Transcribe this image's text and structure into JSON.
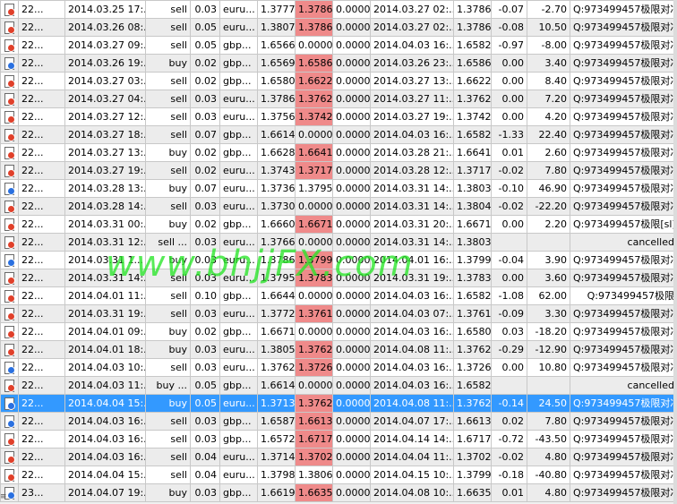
{
  "watermark": "www.bhjjFX.com",
  "left_glyph": "≡",
  "columns": [
    "icon",
    "ticket",
    "open_time",
    "type",
    "volume",
    "symbol",
    "open_price",
    "sl",
    "tp",
    "close_time",
    "close_price",
    "swap",
    "profit",
    "comment"
  ],
  "rows": [
    {
      "icon": "red",
      "ticket": "22...",
      "open_time": "2014.03.25 17:...",
      "type": "sell",
      "volume": "0.03",
      "symbol": "euru...",
      "open_price": "1.3777",
      "sl": "1.3786",
      "sl_hl": true,
      "tp": "0.0000",
      "close_time": "2014.03.27 02:...",
      "close_price": "1.3786",
      "swap": "-0.07",
      "profit": "-2.70",
      "comment": "Q:973499457极限对冲"
    },
    {
      "icon": "red",
      "ticket": "22...",
      "open_time": "2014.03.26 08:...",
      "type": "sell",
      "volume": "0.05",
      "symbol": "euru...",
      "open_price": "1.3807",
      "sl": "1.3786",
      "sl_hl": true,
      "tp": "0.0000",
      "close_time": "2014.03.27 02:...",
      "close_price": "1.3786",
      "swap": "-0.08",
      "profit": "10.50",
      "comment": "Q:973499457极限对冲"
    },
    {
      "icon": "red",
      "ticket": "22...",
      "open_time": "2014.03.27 09:...",
      "type": "sell",
      "volume": "0.05",
      "symbol": "gbp...",
      "open_price": "1.6566",
      "sl": "0.0000",
      "sl_hl": false,
      "tp": "0.0000",
      "close_time": "2014.04.03 16:...",
      "close_price": "1.6582",
      "swap": "-0.97",
      "profit": "-8.00",
      "comment": "Q:973499457极限对冲"
    },
    {
      "icon": "blue",
      "ticket": "22...",
      "open_time": "2014.03.26 19:...",
      "type": "buy",
      "volume": "0.02",
      "symbol": "gbp...",
      "open_price": "1.6569",
      "sl": "1.6586",
      "sl_hl": true,
      "tp": "0.0000",
      "close_time": "2014.03.26 23:...",
      "close_price": "1.6586",
      "swap": "0.00",
      "profit": "3.40",
      "comment": "Q:973499457极限对冲"
    },
    {
      "icon": "red",
      "ticket": "22...",
      "open_time": "2014.03.27 03:...",
      "type": "sell",
      "volume": "0.02",
      "symbol": "gbp...",
      "open_price": "1.6580",
      "sl": "1.6622",
      "sl_hl": true,
      "tp": "0.0000",
      "close_time": "2014.03.27 13:...",
      "close_price": "1.6622",
      "swap": "0.00",
      "profit": "8.40",
      "comment": "Q:973499457极限对冲"
    },
    {
      "icon": "red",
      "ticket": "22...",
      "open_time": "2014.03.27 04:...",
      "type": "sell",
      "volume": "0.03",
      "symbol": "euru...",
      "open_price": "1.3786",
      "sl": "1.3762",
      "sl_hl": true,
      "tp": "0.0000",
      "close_time": "2014.03.27 11:...",
      "close_price": "1.3762",
      "swap": "0.00",
      "profit": "7.20",
      "comment": "Q:973499457极限对冲"
    },
    {
      "icon": "red",
      "ticket": "22...",
      "open_time": "2014.03.27 12:...",
      "type": "sell",
      "volume": "0.03",
      "symbol": "euru...",
      "open_price": "1.3756",
      "sl": "1.3742",
      "sl_hl": true,
      "tp": "0.0000",
      "close_time": "2014.03.27 19:...",
      "close_price": "1.3742",
      "swap": "0.00",
      "profit": "4.20",
      "comment": "Q:973499457极限对冲"
    },
    {
      "icon": "red",
      "ticket": "22...",
      "open_time": "2014.03.27 18:...",
      "type": "sell",
      "volume": "0.07",
      "symbol": "gbp...",
      "open_price": "1.6614",
      "sl": "0.0000",
      "sl_hl": false,
      "tp": "0.0000",
      "close_time": "2014.04.03 16:...",
      "close_price": "1.6582",
      "swap": "-1.33",
      "profit": "22.40",
      "comment": "Q:973499457极限对冲"
    },
    {
      "icon": "red",
      "ticket": "22...",
      "open_time": "2014.03.27 13:...",
      "type": "buy",
      "volume": "0.02",
      "symbol": "gbp...",
      "open_price": "1.6628",
      "sl": "1.6641",
      "sl_hl": true,
      "tp": "0.0000",
      "close_time": "2014.03.28 21:...",
      "close_price": "1.6641",
      "swap": "0.01",
      "profit": "2.60",
      "comment": "Q:973499457极限对冲"
    },
    {
      "icon": "red",
      "ticket": "22...",
      "open_time": "2014.03.27 19:...",
      "type": "sell",
      "volume": "0.02",
      "symbol": "euru...",
      "open_price": "1.3743",
      "sl": "1.3717",
      "sl_hl": true,
      "tp": "0.0000",
      "close_time": "2014.03.28 12:...",
      "close_price": "1.3717",
      "swap": "-0.02",
      "profit": "7.80",
      "comment": "Q:973499457极限对冲"
    },
    {
      "icon": "blue",
      "ticket": "22...",
      "open_time": "2014.03.28 13:...",
      "type": "buy",
      "volume": "0.07",
      "symbol": "euru...",
      "open_price": "1.3736",
      "sl": "1.3795",
      "sl_hl": false,
      "tp": "0.0000",
      "close_time": "2014.03.31 14:...",
      "close_price": "1.3803",
      "swap": "-0.10",
      "profit": "46.90",
      "comment": "Q:973499457极限对冲"
    },
    {
      "icon": "red",
      "ticket": "22...",
      "open_time": "2014.03.28 14:...",
      "type": "sell",
      "volume": "0.03",
      "symbol": "euru...",
      "open_price": "1.3730",
      "sl": "0.0000",
      "sl_hl": false,
      "tp": "0.0000",
      "close_time": "2014.03.31 14:...",
      "close_price": "1.3804",
      "swap": "-0.02",
      "profit": "-22.20",
      "comment": "Q:973499457极限对冲"
    },
    {
      "icon": "red",
      "ticket": "22...",
      "open_time": "2014.03.31 00:...",
      "type": "buy",
      "volume": "0.02",
      "symbol": "gbp...",
      "open_price": "1.6660",
      "sl": "1.6671",
      "sl_hl": true,
      "tp": "0.0000",
      "close_time": "2014.03.31 20:...",
      "close_price": "1.6671",
      "swap": "0.00",
      "profit": "2.20",
      "comment": "Q:973499457极限[sl]"
    },
    {
      "icon": "red",
      "ticket": "22...",
      "open_time": "2014.03.31 12:...",
      "type": "sell ...",
      "volume": "0.03",
      "symbol": "euru...",
      "open_price": "1.3766",
      "sl": "0.0000",
      "sl_hl": false,
      "tp": "0.0000",
      "close_time": "2014.03.31 14:...",
      "close_price": "1.3803",
      "swap": "",
      "profit": "",
      "comment": "cancelled"
    },
    {
      "icon": "blue",
      "ticket": "22...",
      "open_time": "2014.03.31 1...",
      "type": "buy",
      "volume": "0.03",
      "symbol": "euru...",
      "open_price": "1.3786",
      "sl": "1.3799",
      "sl_hl": true,
      "tp": "0.0000",
      "close_time": "2014.04.01 16:...",
      "close_price": "1.3799",
      "swap": "-0.04",
      "profit": "3.90",
      "comment": "Q:973499457极限对冲"
    },
    {
      "icon": "red",
      "ticket": "22...",
      "open_time": "2014.03.31 14:...",
      "type": "sell",
      "volume": "0.03",
      "symbol": "euru...",
      "open_price": "1.3795",
      "sl": "1.3783",
      "sl_hl": true,
      "tp": "0.0000",
      "close_time": "2014.03.31 19:...",
      "close_price": "1.3783",
      "swap": "0.00",
      "profit": "3.60",
      "comment": "Q:973499457极限对冲"
    },
    {
      "icon": "red",
      "ticket": "22...",
      "open_time": "2014.04.01 11:...",
      "type": "sell",
      "volume": "0.10",
      "symbol": "gbp...",
      "open_price": "1.6644",
      "sl": "0.0000",
      "sl_hl": false,
      "tp": "0.0000",
      "close_time": "2014.04.03 16:...",
      "close_price": "1.6582",
      "swap": "-1.08",
      "profit": "62.00",
      "comment": "Q:973499457极限"
    },
    {
      "icon": "red",
      "ticket": "22...",
      "open_time": "2014.03.31 19:...",
      "type": "sell",
      "volume": "0.03",
      "symbol": "euru...",
      "open_price": "1.3772",
      "sl": "1.3761",
      "sl_hl": true,
      "tp": "0.0000",
      "close_time": "2014.04.03 07:...",
      "close_price": "1.3761",
      "swap": "-0.09",
      "profit": "3.30",
      "comment": "Q:973499457极限对冲"
    },
    {
      "icon": "red",
      "ticket": "22...",
      "open_time": "2014.04.01 09:...",
      "type": "buy",
      "volume": "0.02",
      "symbol": "gbp...",
      "open_price": "1.6671",
      "sl": "0.0000",
      "sl_hl": false,
      "tp": "0.0000",
      "close_time": "2014.04.03 16:...",
      "close_price": "1.6580",
      "swap": "0.03",
      "profit": "-18.20",
      "comment": "Q:973499457极限对冲"
    },
    {
      "icon": "red",
      "ticket": "22...",
      "open_time": "2014.04.01 18:...",
      "type": "buy",
      "volume": "0.03",
      "symbol": "euru...",
      "open_price": "1.3805",
      "sl": "1.3762",
      "sl_hl": true,
      "tp": "0.0000",
      "close_time": "2014.04.08 11:...",
      "close_price": "1.3762",
      "swap": "-0.29",
      "profit": "-12.90",
      "comment": "Q:973499457极限对冲"
    },
    {
      "icon": "blue",
      "ticket": "22...",
      "open_time": "2014.04.03 10:...",
      "type": "sell",
      "volume": "0.03",
      "symbol": "euru...",
      "open_price": "1.3762",
      "sl": "1.3726",
      "sl_hl": true,
      "tp": "0.0000",
      "close_time": "2014.04.03 16:...",
      "close_price": "1.3726",
      "swap": "0.00",
      "profit": "10.80",
      "comment": "Q:973499457极限对冲"
    },
    {
      "icon": "red",
      "ticket": "22...",
      "open_time": "2014.04.03 11:...",
      "type": "buy ...",
      "volume": "0.05",
      "symbol": "gbp...",
      "open_price": "1.6614",
      "sl": "0.0000",
      "sl_hl": false,
      "tp": "0.0000",
      "close_time": "2014.04.03 16:...",
      "close_price": "1.6582",
      "swap": "",
      "profit": "",
      "comment": "cancelled"
    },
    {
      "icon": "blue",
      "ticket": "22...",
      "open_time": "2014.04.04 15:...",
      "type": "buy",
      "volume": "0.05",
      "symbol": "euru...",
      "open_price": "1.3713",
      "sl": "1.3762",
      "sl_hl": true,
      "tp": "0.0000",
      "close_time": "2014.04.08 11:...",
      "close_price": "1.3762",
      "swap": "-0.14",
      "profit": "24.50",
      "comment": "Q:973499457极限对冲",
      "selected": true
    },
    {
      "icon": "blue",
      "ticket": "22...",
      "open_time": "2014.04.03 16:...",
      "type": "sell",
      "volume": "0.03",
      "symbol": "gbp...",
      "open_price": "1.6587",
      "sl": "1.6613",
      "sl_hl": true,
      "tp": "0.0000",
      "close_time": "2014.04.07 17:...",
      "close_price": "1.6613",
      "swap": "0.02",
      "profit": "7.80",
      "comment": "Q:973499457极限对冲"
    },
    {
      "icon": "red",
      "ticket": "22...",
      "open_time": "2014.04.03 16:...",
      "type": "sell",
      "volume": "0.03",
      "symbol": "gbp...",
      "open_price": "1.6572",
      "sl": "1.6717",
      "sl_hl": true,
      "tp": "0.0000",
      "close_time": "2014.04.14 14:...",
      "close_price": "1.6717",
      "swap": "-0.72",
      "profit": "-43.50",
      "comment": "Q:973499457极限对冲"
    },
    {
      "icon": "red",
      "ticket": "22...",
      "open_time": "2014.04.03 16:...",
      "type": "sell",
      "volume": "0.04",
      "symbol": "euru...",
      "open_price": "1.3714",
      "sl": "1.3702",
      "sl_hl": true,
      "tp": "0.0000",
      "close_time": "2014.04.04 11:...",
      "close_price": "1.3702",
      "swap": "-0.02",
      "profit": "4.80",
      "comment": "Q:973499457极限对冲"
    },
    {
      "icon": "red",
      "ticket": "22...",
      "open_time": "2014.04.04 15:...",
      "type": "sell",
      "volume": "0.04",
      "symbol": "euru...",
      "open_price": "1.3798",
      "sl": "1.3806",
      "sl_hl": false,
      "tp": "0.0000",
      "close_time": "2014.04.15 10:...",
      "close_price": "1.3799",
      "swap": "-0.18",
      "profit": "-40.80",
      "comment": "Q:973499457极限对冲"
    },
    {
      "icon": "blue",
      "ticket": "23...",
      "open_time": "2014.04.07 19:...",
      "type": "buy",
      "volume": "0.03",
      "symbol": "gbp...",
      "open_price": "1.6619",
      "sl": "1.6635",
      "sl_hl": true,
      "tp": "0.0000",
      "close_time": "2014.04.08 10:...",
      "close_price": "1.6635",
      "swap": "0.01",
      "profit": "4.80",
      "comment": "Q:973499457极限对冲"
    }
  ]
}
